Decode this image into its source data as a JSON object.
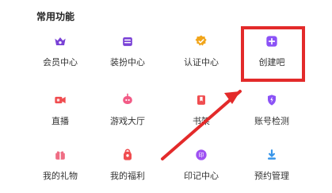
{
  "section": {
    "title": "常用功能"
  },
  "items": [
    {
      "label": "会员中心",
      "icon": "crown-icon",
      "color": "#7a42d6"
    },
    {
      "label": "装扮中心",
      "icon": "bag-icon",
      "color": "#7a42d6"
    },
    {
      "label": "认证中心",
      "icon": "certificate-icon",
      "color": "#f1a51a"
    },
    {
      "label": "创建吧",
      "icon": "plus-icon",
      "color": "#8b52f6"
    },
    {
      "label": "直播",
      "icon": "video-icon",
      "color": "#f04d50"
    },
    {
      "label": "游戏大厅",
      "icon": "game-icon",
      "color": "#f25b86"
    },
    {
      "label": "书架",
      "icon": "book-icon",
      "color": "#f04d50"
    },
    {
      "label": "账号检测",
      "icon": "shield-lightning-icon",
      "color": "#8b52f6"
    },
    {
      "label": "我的礼物",
      "icon": "gift-icon",
      "color": "#ef6d84"
    },
    {
      "label": "我的福利",
      "icon": "bag-gift-icon",
      "color": "#f04d50"
    },
    {
      "label": "印记中心",
      "icon": "seal-icon",
      "color": "#9f51f2"
    },
    {
      "label": "预约管理",
      "icon": "download-icon",
      "color": "#3795e9"
    }
  ],
  "annotation": {
    "highlight_color": "#e32a2a"
  }
}
